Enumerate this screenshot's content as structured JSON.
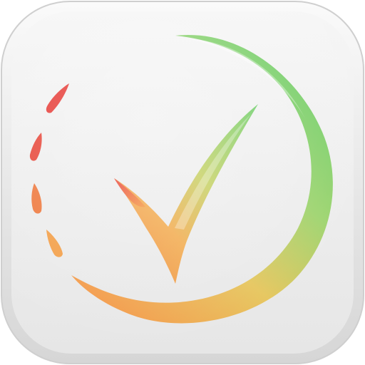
{
  "icon": {
    "name": "check-timer-app-icon",
    "tile_colors": {
      "outer_rim": "#dcdcdc",
      "rim_highlight": "#f7f7f7",
      "face_top": "#f6f6f6",
      "face_bottom": "#e4e4e4"
    },
    "gradient_colors": {
      "red": "#e8403a",
      "orange": "#f49a45",
      "yellow": "#e8c659",
      "green": "#6fcf6c",
      "green_light": "#8fdc7a"
    }
  }
}
